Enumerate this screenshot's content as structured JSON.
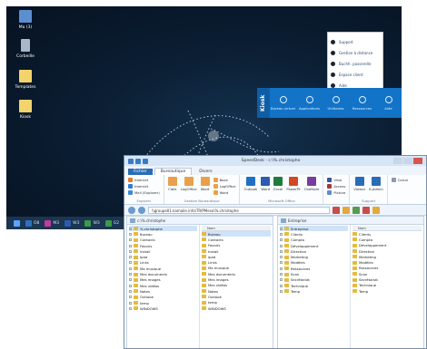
{
  "desktop": {
    "icons": [
      {
        "label": "Ma (3)",
        "color": "#5a8fd0"
      },
      {
        "label": "Corbeille",
        "color": "#a9b8c7"
      },
      {
        "label": "Templates",
        "color": "#f3d36b"
      },
      {
        "label": "Kiosk",
        "color": "#f3d36b"
      }
    ],
    "taskbar": [
      {
        "label": "O8",
        "color": "#2f6fc2"
      },
      {
        "label": "M3",
        "color": "#c33b9c"
      },
      {
        "label": "W3",
        "color": "#2a5cb0"
      },
      {
        "label": "W3",
        "color": "#3a9a46"
      },
      {
        "label": "G2",
        "color": "#3a9a46"
      }
    ]
  },
  "popup": {
    "items": [
      "Support",
      "Gestion à distance",
      "Buchh. passerelle",
      "Espace client",
      "Aide"
    ]
  },
  "kiosk": {
    "logo": "Kiosk",
    "buttons": [
      "Bureau virtuel",
      "Applications",
      "Utilitaires",
      "Ressources",
      "Aide"
    ]
  },
  "window": {
    "title": "SpeedDesk - c:\\%.christophe",
    "tabs": {
      "file": "Fichier",
      "home": "Bureautique",
      "other": "Divers"
    },
    "ribbon": {
      "groups": [
        {
          "label": "Explorer",
          "small": [
            "Internet",
            "Internet",
            "Mail (Explorer)"
          ]
        },
        {
          "label": "Gestion Bureautique",
          "items": [
            "Cible",
            "LogOffice",
            "Word"
          ],
          "small": [
            "Base",
            "LogOffice",
            "Word"
          ]
        },
        {
          "label": "Microsoft Office",
          "items": [
            "Outlook",
            "Word",
            "Excel",
            "PowerPt",
            "OneNote"
          ]
        },
        {
          "label": "",
          "small": [
            "Visio",
            "Access",
            "Picture"
          ]
        },
        {
          "label": "Support",
          "items": [
            "Viewer",
            "K-Admin"
          ]
        },
        {
          "label": "",
          "small": [
            "Calcul"
          ]
        }
      ]
    },
    "address": "\\\\groupe01.kamaile.info\\TRIPMeso\\%.christophe",
    "left_pane": {
      "header": "c:\\%.christophe",
      "tree": [
        "%.christophe",
        "Bureau",
        "Contacts",
        "Favoris",
        "Install",
        "ipad",
        "Links",
        "Ma musique",
        "Mes documents",
        "Mes images",
        "Mes vidéos",
        "Notes",
        "Outlook",
        "temp",
        "WINDOWS"
      ],
      "list_header": "Nom",
      "list": [
        "Bureau",
        "Contacts",
        "Favoris",
        "Install",
        "ipad",
        "Links",
        "Ma musique",
        "Mes documents",
        "Mes images",
        "Mes vidéos",
        "Notes",
        "Outlook",
        "temp",
        "WINDOWS"
      ]
    },
    "right_pane": {
      "header": "Entreprise",
      "tree": [
        "Entreprise",
        "Clients",
        "Compta",
        "Développement",
        "Direction",
        "Marketing",
        "Modèles",
        "Ressources",
        "Scan",
        "Secrétariat",
        "Technique",
        "Temp"
      ],
      "list_header": "Nom",
      "list": [
        "Clients",
        "Compta",
        "Développement",
        "Direction",
        "Marketing",
        "Modèles",
        "Ressources",
        "Scan",
        "Secrétariat",
        "Technique",
        "Temp"
      ]
    }
  }
}
